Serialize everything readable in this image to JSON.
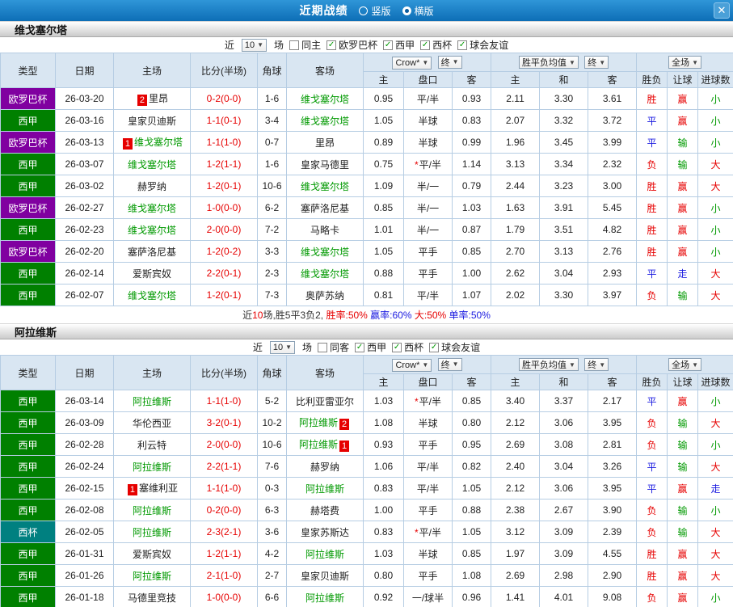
{
  "window": {
    "title": "近期战绩",
    "view_options": [
      {
        "label": "竖版",
        "selected": false
      },
      {
        "label": "横版",
        "selected": true
      }
    ],
    "close_icon": "✕"
  },
  "filter_labels": {
    "near": "近",
    "count": "10",
    "games": "场"
  },
  "header": {
    "type": "类型",
    "date": "日期",
    "home": "主场",
    "score": "比分(半场)",
    "corner": "角球",
    "away": "客场",
    "odds_dropdown": "Crow*",
    "final1": "终",
    "avg_dropdown": "胜平负均值",
    "final2": "终",
    "scope_dropdown": "全场",
    "sub": {
      "home": "主",
      "handicap": "盘口",
      "away": "客",
      "avg_home": "主",
      "avg_draw": "和",
      "avg_away": "客",
      "result": "胜负",
      "let": "让球",
      "goals": "进球数"
    }
  },
  "colors": {
    "red": "#e60000",
    "blue": "#1a1ae0",
    "green": "#009900",
    "purple": "#8000a0",
    "league_green": "#008000",
    "teal": "#008080"
  },
  "sections": [
    {
      "team": "维戈塞尔塔",
      "filters": [
        {
          "label": "同主",
          "checked": false
        },
        {
          "label": "欧罗巴杯",
          "checked": true
        },
        {
          "label": "西甲",
          "checked": true
        },
        {
          "label": "西杯",
          "checked": true
        },
        {
          "label": "球会友谊",
          "checked": true
        }
      ],
      "rows": [
        {
          "comp": "欧罗巴杯",
          "comp_color": "purple",
          "date": "26-03-20",
          "home": "里昂",
          "home_badge": "2",
          "home_focus": false,
          "score": "0-2(0-0)",
          "corner": "1-6",
          "away": "维戈塞尔塔",
          "away_focus": true,
          "o1": "0.95",
          "hc": "平/半",
          "star": false,
          "o2": "0.93",
          "a1": "2.11",
          "a2": "3.30",
          "a3": "3.61",
          "r": "胜",
          "rc": "red",
          "l": "赢",
          "lc": "red",
          "g": "小",
          "gc": "green"
        },
        {
          "comp": "西甲",
          "comp_color": "league_green",
          "date": "26-03-16",
          "home": "皇家贝迪斯",
          "home_focus": false,
          "score": "1-1(0-1)",
          "corner": "3-4",
          "away": "维戈塞尔塔",
          "away_focus": true,
          "o1": "1.05",
          "hc": "半球",
          "star": false,
          "o2": "0.83",
          "a1": "2.07",
          "a2": "3.32",
          "a3": "3.72",
          "r": "平",
          "rc": "blue",
          "l": "赢",
          "lc": "red",
          "g": "小",
          "gc": "green"
        },
        {
          "comp": "欧罗巴杯",
          "comp_color": "purple",
          "date": "26-03-13",
          "home": "维戈塞尔塔",
          "home_badge": "1",
          "home_focus": true,
          "score": "1-1(1-0)",
          "corner": "0-7",
          "away": "里昂",
          "away_focus": false,
          "o1": "0.89",
          "hc": "半球",
          "star": false,
          "o2": "0.99",
          "a1": "1.96",
          "a2": "3.45",
          "a3": "3.99",
          "r": "平",
          "rc": "blue",
          "l": "输",
          "lc": "green",
          "g": "小",
          "gc": "green"
        },
        {
          "comp": "西甲",
          "comp_color": "league_green",
          "date": "26-03-07",
          "home": "维戈塞尔塔",
          "home_focus": true,
          "score": "1-2(1-1)",
          "corner": "1-6",
          "away": "皇家马德里",
          "away_focus": false,
          "o1": "0.75",
          "hc": "平/半",
          "star": true,
          "o2": "1.14",
          "a1": "3.13",
          "a2": "3.34",
          "a3": "2.32",
          "r": "负",
          "rc": "red",
          "l": "输",
          "lc": "green",
          "g": "大",
          "gc": "red"
        },
        {
          "comp": "西甲",
          "comp_color": "league_green",
          "date": "26-03-02",
          "home": "赫罗纳",
          "home_focus": false,
          "score": "1-2(0-1)",
          "corner": "10-6",
          "away": "维戈塞尔塔",
          "away_focus": true,
          "o1": "1.09",
          "hc": "半/一",
          "star": false,
          "o2": "0.79",
          "a1": "2.44",
          "a2": "3.23",
          "a3": "3.00",
          "r": "胜",
          "rc": "red",
          "l": "赢",
          "lc": "red",
          "g": "大",
          "gc": "red"
        },
        {
          "comp": "欧罗巴杯",
          "comp_color": "purple",
          "date": "26-02-27",
          "home": "维戈塞尔塔",
          "home_focus": true,
          "score": "1-0(0-0)",
          "corner": "6-2",
          "away": "塞萨洛尼基",
          "away_focus": false,
          "o1": "0.85",
          "hc": "半/一",
          "star": false,
          "o2": "1.03",
          "a1": "1.63",
          "a2": "3.91",
          "a3": "5.45",
          "r": "胜",
          "rc": "red",
          "l": "赢",
          "lc": "red",
          "g": "小",
          "gc": "green"
        },
        {
          "comp": "西甲",
          "comp_color": "league_green",
          "date": "26-02-23",
          "home": "维戈塞尔塔",
          "home_focus": true,
          "score": "2-0(0-0)",
          "corner": "7-2",
          "away": "马略卡",
          "away_focus": false,
          "o1": "1.01",
          "hc": "半/一",
          "star": false,
          "o2": "0.87",
          "a1": "1.79",
          "a2": "3.51",
          "a3": "4.82",
          "r": "胜",
          "rc": "red",
          "l": "赢",
          "lc": "red",
          "g": "小",
          "gc": "green"
        },
        {
          "comp": "欧罗巴杯",
          "comp_color": "purple",
          "date": "26-02-20",
          "home": "塞萨洛尼基",
          "home_focus": false,
          "score": "1-2(0-2)",
          "corner": "3-3",
          "away": "维戈塞尔塔",
          "away_focus": true,
          "o1": "1.05",
          "hc": "平手",
          "star": false,
          "o2": "0.85",
          "a1": "2.70",
          "a2": "3.13",
          "a3": "2.76",
          "r": "胜",
          "rc": "red",
          "l": "赢",
          "lc": "red",
          "g": "小",
          "gc": "green"
        },
        {
          "comp": "西甲",
          "comp_color": "league_green",
          "date": "26-02-14",
          "home": "爱斯宾奴",
          "home_focus": false,
          "score": "2-2(0-1)",
          "corner": "2-3",
          "away": "维戈塞尔塔",
          "away_focus": true,
          "o1": "0.88",
          "hc": "平手",
          "star": false,
          "o2": "1.00",
          "a1": "2.62",
          "a2": "3.04",
          "a3": "2.93",
          "r": "平",
          "rc": "blue",
          "l": "走",
          "lc": "blue",
          "g": "大",
          "gc": "red"
        },
        {
          "comp": "西甲",
          "comp_color": "league_green",
          "date": "26-02-07",
          "home": "维戈塞尔塔",
          "home_focus": true,
          "score": "1-2(0-1)",
          "corner": "7-3",
          "away": "奥萨苏纳",
          "away_focus": false,
          "o1": "0.81",
          "hc": "平/半",
          "star": false,
          "o2": "1.07",
          "a1": "2.02",
          "a2": "3.30",
          "a3": "3.97",
          "r": "负",
          "rc": "red",
          "l": "输",
          "lc": "green",
          "g": "大",
          "gc": "red"
        }
      ],
      "summary": [
        {
          "t": "近",
          "c": "#333333"
        },
        {
          "t": "10",
          "c": "red"
        },
        {
          "t": "场,胜5平3负2, ",
          "c": "#333333"
        },
        {
          "t": "胜率:50%",
          "c": "red"
        },
        {
          "t": " 赢率:60%",
          "c": "blue"
        },
        {
          "t": " 大:50%",
          "c": "red"
        },
        {
          "t": " 单率:50%",
          "c": "blue"
        }
      ]
    },
    {
      "team": "阿拉维斯",
      "filters": [
        {
          "label": "同客",
          "checked": false
        },
        {
          "label": "西甲",
          "checked": true
        },
        {
          "label": "西杯",
          "checked": true
        },
        {
          "label": "球会友谊",
          "checked": true
        }
      ],
      "rows": [
        {
          "comp": "西甲",
          "comp_color": "league_green",
          "date": "26-03-14",
          "home": "阿拉维斯",
          "home_focus": true,
          "score": "1-1(1-0)",
          "corner": "5-2",
          "away": "比利亚雷亚尔",
          "away_focus": false,
          "o1": "1.03",
          "hc": "平/半",
          "star": true,
          "o2": "0.85",
          "a1": "3.40",
          "a2": "3.37",
          "a3": "2.17",
          "r": "平",
          "rc": "blue",
          "l": "赢",
          "lc": "red",
          "g": "小",
          "gc": "green"
        },
        {
          "comp": "西甲",
          "comp_color": "league_green",
          "date": "26-03-09",
          "home": "华伦西亚",
          "home_focus": false,
          "score": "3-2(0-1)",
          "corner": "10-2",
          "away": "阿拉维斯",
          "away_badge": "2",
          "away_focus": true,
          "o1": "1.08",
          "hc": "半球",
          "star": false,
          "o2": "0.80",
          "a1": "2.12",
          "a2": "3.06",
          "a3": "3.95",
          "r": "负",
          "rc": "red",
          "l": "输",
          "lc": "green",
          "g": "大",
          "gc": "red"
        },
        {
          "comp": "西甲",
          "comp_color": "league_green",
          "date": "26-02-28",
          "home": "利云特",
          "home_focus": false,
          "score": "2-0(0-0)",
          "corner": "10-6",
          "away": "阿拉维斯",
          "away_badge": "1",
          "away_focus": true,
          "o1": "0.93",
          "hc": "平手",
          "star": false,
          "o2": "0.95",
          "a1": "2.69",
          "a2": "3.08",
          "a3": "2.81",
          "r": "负",
          "rc": "red",
          "l": "输",
          "lc": "green",
          "g": "小",
          "gc": "green"
        },
        {
          "comp": "西甲",
          "comp_color": "league_green",
          "date": "26-02-24",
          "home": "阿拉维斯",
          "home_focus": true,
          "score": "2-2(1-1)",
          "corner": "7-6",
          "away": "赫罗纳",
          "away_focus": false,
          "o1": "1.06",
          "hc": "平/半",
          "star": false,
          "o2": "0.82",
          "a1": "2.40",
          "a2": "3.04",
          "a3": "3.26",
          "r": "平",
          "rc": "blue",
          "l": "输",
          "lc": "green",
          "g": "大",
          "gc": "red"
        },
        {
          "comp": "西甲",
          "comp_color": "league_green",
          "date": "26-02-15",
          "home": "塞维利亚",
          "home_badge": "1",
          "home_focus": false,
          "score": "1-1(1-0)",
          "corner": "0-3",
          "away": "阿拉维斯",
          "away_focus": true,
          "o1": "0.83",
          "hc": "平/半",
          "star": false,
          "o2": "1.05",
          "a1": "2.12",
          "a2": "3.06",
          "a3": "3.95",
          "r": "平",
          "rc": "blue",
          "l": "赢",
          "lc": "red",
          "g": "走",
          "gc": "blue"
        },
        {
          "comp": "西甲",
          "comp_color": "league_green",
          "date": "26-02-08",
          "home": "阿拉维斯",
          "home_focus": true,
          "score": "0-2(0-0)",
          "corner": "6-3",
          "away": "赫塔费",
          "away_focus": false,
          "o1": "1.00",
          "hc": "平手",
          "star": false,
          "o2": "0.88",
          "a1": "2.38",
          "a2": "2.67",
          "a3": "3.90",
          "r": "负",
          "rc": "red",
          "l": "输",
          "lc": "green",
          "g": "小",
          "gc": "green"
        },
        {
          "comp": "西杯",
          "comp_color": "teal",
          "date": "26-02-05",
          "home": "阿拉维斯",
          "home_focus": true,
          "score": "2-3(2-1)",
          "corner": "3-6",
          "away": "皇家苏斯达",
          "away_focus": false,
          "o1": "0.83",
          "hc": "平/半",
          "star": true,
          "o2": "1.05",
          "a1": "3.12",
          "a2": "3.09",
          "a3": "2.39",
          "r": "负",
          "rc": "red",
          "l": "输",
          "lc": "green",
          "g": "大",
          "gc": "red"
        },
        {
          "comp": "西甲",
          "comp_color": "league_green",
          "date": "26-01-31",
          "home": "爱斯宾奴",
          "home_focus": false,
          "score": "1-2(1-1)",
          "corner": "4-2",
          "away": "阿拉维斯",
          "away_focus": true,
          "o1": "1.03",
          "hc": "半球",
          "star": false,
          "o2": "0.85",
          "a1": "1.97",
          "a2": "3.09",
          "a3": "4.55",
          "r": "胜",
          "rc": "red",
          "l": "赢",
          "lc": "red",
          "g": "大",
          "gc": "red"
        },
        {
          "comp": "西甲",
          "comp_color": "league_green",
          "date": "26-01-26",
          "home": "阿拉维斯",
          "home_focus": true,
          "score": "2-1(1-0)",
          "corner": "2-7",
          "away": "皇家贝迪斯",
          "away_focus": false,
          "o1": "0.80",
          "hc": "平手",
          "star": false,
          "o2": "1.08",
          "a1": "2.69",
          "a2": "2.98",
          "a3": "2.90",
          "r": "胜",
          "rc": "red",
          "l": "赢",
          "lc": "red",
          "g": "大",
          "gc": "red"
        },
        {
          "comp": "西甲",
          "comp_color": "league_green",
          "date": "26-01-18",
          "home": "马德里竞技",
          "home_focus": false,
          "score": "1-0(0-0)",
          "corner": "6-6",
          "away": "阿拉维斯",
          "away_focus": true,
          "o1": "0.92",
          "hc": "一/球半",
          "star": false,
          "o2": "0.96",
          "a1": "1.41",
          "a2": "4.01",
          "a3": "9.08",
          "r": "负",
          "rc": "red",
          "l": "赢",
          "lc": "red",
          "g": "小",
          "gc": "green"
        }
      ],
      "summary": null
    }
  ]
}
